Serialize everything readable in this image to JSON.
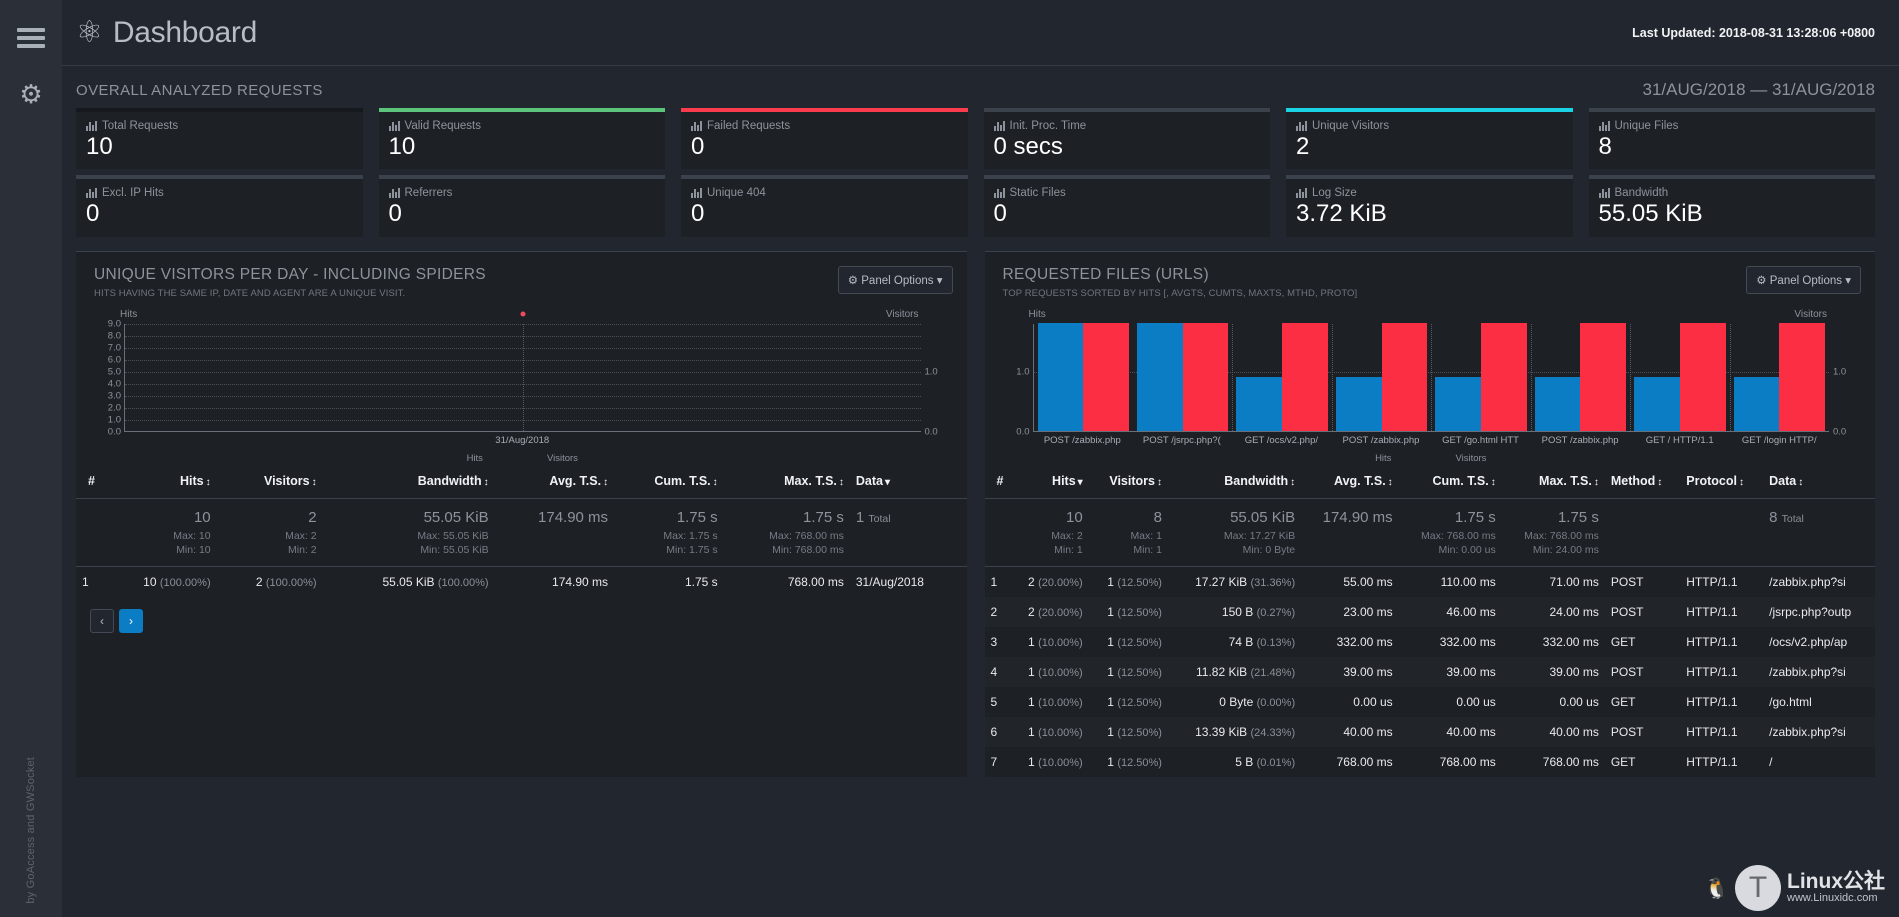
{
  "rail": {
    "menu_icon": "hamburger-icon",
    "settings_icon": "gear-icon",
    "credit": "by GoAccess and GWSocket"
  },
  "header": {
    "logo_icon": "goaccess-logo-icon",
    "title": "Dashboard",
    "last_updated": "Last Updated: 2018-08-31 13:28:06 +0800"
  },
  "overview": {
    "title": "OVERALL ANALYZED REQUESTS",
    "date_range": "31/AUG/2018 — 31/AUG/2018",
    "cards": [
      {
        "label": "Total Requests",
        "value": "10",
        "accent": "#15181d",
        "sub_label": "Excl. IP Hits",
        "sub_value": "0"
      },
      {
        "label": "Valid Requests",
        "value": "10",
        "accent": "#5cc47c",
        "sub_label": "Referrers",
        "sub_value": "0"
      },
      {
        "label": "Failed Requests",
        "value": "0",
        "accent": "#fb3b4e",
        "sub_label": "Unique 404",
        "sub_value": "0"
      },
      {
        "label": "Init. Proc. Time",
        "value": "0 secs",
        "accent": "#3c424c",
        "sub_label": "Static Files",
        "sub_value": "0"
      },
      {
        "label": "Unique Visitors",
        "value": "2",
        "accent": "#1ad4e6",
        "sub_label": "Log Size",
        "sub_value": "3.72 KiB"
      },
      {
        "label": "Unique Files",
        "value": "8",
        "accent": "#3c424c",
        "sub_label": "Bandwidth",
        "sub_value": "55.05 KiB"
      }
    ]
  },
  "panel_left": {
    "title": "UNIQUE VISITORS PER DAY - INCLUDING SPIDERS",
    "subtitle": "HITS HAVING THE SAME IP, DATE AND AGENT ARE A UNIQUE VISIT.",
    "options_label": "Panel Options",
    "options_icon": "gear-icon",
    "headers": [
      {
        "label": "#",
        "sort": ""
      },
      {
        "label": "Hits",
        "sort": "both"
      },
      {
        "label": "Visitors",
        "sort": "both"
      },
      {
        "label": "Bandwidth",
        "sort": "both"
      },
      {
        "label": "Avg. T.S.",
        "sort": "both"
      },
      {
        "label": "Cum. T.S.",
        "sort": "both"
      },
      {
        "label": "Max. T.S.",
        "sort": "both"
      },
      {
        "label": "Data",
        "sort": "desc"
      }
    ],
    "summary": {
      "hits": "10",
      "visitors": "2",
      "bandwidth": "55.05 KiB",
      "avg_ts": "174.90 ms",
      "cum_ts": "1.75 s",
      "max_ts": "1.75 s",
      "data": "1",
      "data_total_label": "Total",
      "max": {
        "hits": "Max: 10",
        "visitors": "Max: 2",
        "bandwidth": "Max: 55.05 KiB",
        "avg_ts": "",
        "cum_ts": "Max: 1.75 s",
        "max_ts": "Max: 768.00 ms"
      },
      "min": {
        "hits": "Min: 10",
        "visitors": "Min: 2",
        "bandwidth": "Min: 55.05 KiB",
        "avg_ts": "",
        "cum_ts": "Min: 1.75 s",
        "max_ts": "Min: 768.00 ms"
      }
    },
    "rows": [
      {
        "idx": "1",
        "hits": "10",
        "hits_pct": "(100.00%)",
        "visitors": "2",
        "visitors_pct": "(100.00%)",
        "bandwidth": "55.05 KiB",
        "bandwidth_pct": "(100.00%)",
        "avg_ts": "174.90 ms",
        "cum_ts": "1.75 s",
        "max_ts": "768.00 ms",
        "data": "31/Aug/2018"
      }
    ],
    "pager": {
      "prev": "‹",
      "next": "›"
    }
  },
  "panel_right": {
    "title": "REQUESTED FILES (URLS)",
    "subtitle": "TOP REQUESTS SORTED BY HITS [, AVGTS, CUMTS, MAXTS, MTHD, PROTO]",
    "options_label": "Panel Options",
    "options_icon": "gear-icon",
    "headers": [
      {
        "label": "#",
        "sort": ""
      },
      {
        "label": "Hits",
        "sort": "desc"
      },
      {
        "label": "Visitors",
        "sort": "both"
      },
      {
        "label": "Bandwidth",
        "sort": "both"
      },
      {
        "label": "Avg. T.S.",
        "sort": "both"
      },
      {
        "label": "Cum. T.S.",
        "sort": "both"
      },
      {
        "label": "Max. T.S.",
        "sort": "both"
      },
      {
        "label": "Method",
        "sort": "both"
      },
      {
        "label": "Protocol",
        "sort": "both"
      },
      {
        "label": "Data",
        "sort": "both"
      }
    ],
    "summary": {
      "hits": "10",
      "visitors": "8",
      "bandwidth": "55.05 KiB",
      "avg_ts": "174.90 ms",
      "cum_ts": "1.75 s",
      "max_ts": "1.75 s",
      "data": "8",
      "data_total_label": "Total",
      "max": {
        "hits": "Max: 2",
        "visitors": "Max: 1",
        "bandwidth": "Max: 17.27 KiB",
        "avg_ts": "",
        "cum_ts": "Max: 768.00 ms",
        "max_ts": "Max: 768.00 ms"
      },
      "min": {
        "hits": "Min: 1",
        "visitors": "Min: 1",
        "bandwidth": "Min: 0 Byte",
        "avg_ts": "",
        "cum_ts": "Min: 0.00 us",
        "max_ts": "Min: 24.00 ms"
      }
    },
    "rows": [
      {
        "idx": "1",
        "hits": "2",
        "hits_pct": "(20.00%)",
        "visitors": "1",
        "visitors_pct": "(12.50%)",
        "bandwidth": "17.27 KiB",
        "bandwidth_pct": "(31.36%)",
        "avg_ts": "55.00 ms",
        "cum_ts": "110.00 ms",
        "max_ts": "71.00 ms",
        "method": "POST",
        "protocol": "HTTP/1.1",
        "data": "/zabbix.php?si"
      },
      {
        "idx": "2",
        "hits": "2",
        "hits_pct": "(20.00%)",
        "visitors": "1",
        "visitors_pct": "(12.50%)",
        "bandwidth": "150 B",
        "bandwidth_pct": "(0.27%)",
        "avg_ts": "23.00 ms",
        "cum_ts": "46.00 ms",
        "max_ts": "24.00 ms",
        "method": "POST",
        "protocol": "HTTP/1.1",
        "data": "/jsrpc.php?outp"
      },
      {
        "idx": "3",
        "hits": "1",
        "hits_pct": "(10.00%)",
        "visitors": "1",
        "visitors_pct": "(12.50%)",
        "bandwidth": "74 B",
        "bandwidth_pct": "(0.13%)",
        "avg_ts": "332.00 ms",
        "cum_ts": "332.00 ms",
        "max_ts": "332.00 ms",
        "method": "GET",
        "protocol": "HTTP/1.1",
        "data": "/ocs/v2.php/ap"
      },
      {
        "idx": "4",
        "hits": "1",
        "hits_pct": "(10.00%)",
        "visitors": "1",
        "visitors_pct": "(12.50%)",
        "bandwidth": "11.82 KiB",
        "bandwidth_pct": "(21.48%)",
        "avg_ts": "39.00 ms",
        "cum_ts": "39.00 ms",
        "max_ts": "39.00 ms",
        "method": "POST",
        "protocol": "HTTP/1.1",
        "data": "/zabbix.php?si"
      },
      {
        "idx": "5",
        "hits": "1",
        "hits_pct": "(10.00%)",
        "visitors": "1",
        "visitors_pct": "(12.50%)",
        "bandwidth": "0 Byte",
        "bandwidth_pct": "(0.00%)",
        "avg_ts": "0.00 us",
        "cum_ts": "0.00 us",
        "max_ts": "0.00 us",
        "method": "GET",
        "protocol": "HTTP/1.1",
        "data": "/go.html"
      },
      {
        "idx": "6",
        "hits": "1",
        "hits_pct": "(10.00%)",
        "visitors": "1",
        "visitors_pct": "(12.50%)",
        "bandwidth": "13.39 KiB",
        "bandwidth_pct": "(24.33%)",
        "avg_ts": "40.00 ms",
        "cum_ts": "40.00 ms",
        "max_ts": "40.00 ms",
        "method": "POST",
        "protocol": "HTTP/1.1",
        "data": "/zabbix.php?si"
      },
      {
        "idx": "7",
        "hits": "1",
        "hits_pct": "(10.00%)",
        "visitors": "1",
        "visitors_pct": "(12.50%)",
        "bandwidth": "5 B",
        "bandwidth_pct": "(0.01%)",
        "avg_ts": "768.00 ms",
        "cum_ts": "768.00 ms",
        "max_ts": "768.00 ms",
        "method": "GET",
        "protocol": "HTTP/1.1",
        "data": "/"
      }
    ]
  },
  "chart_data": [
    {
      "type": "line",
      "title": "UNIQUE VISITORS PER DAY - INCLUDING SPIDERS",
      "xlabel": "",
      "ylabel": "Hits",
      "y2label": "Visitors",
      "categories": [
        "31/Aug/2018"
      ],
      "series": [
        {
          "name": "Hits",
          "values": [
            10
          ]
        },
        {
          "name": "Visitors",
          "values": [
            2
          ]
        }
      ],
      "yticks": [
        "9.0",
        "8.0",
        "7.0",
        "6.0",
        "5.0",
        "4.0",
        "3.0",
        "2.0",
        "1.0",
        "0.0"
      ],
      "ylim": [
        0,
        10
      ],
      "y2ticks": [
        "1.0",
        "0.0"
      ],
      "y2lim": [
        0,
        2
      ],
      "grid": true,
      "legend": [
        "Hits",
        "Visitors"
      ],
      "legend_position": "bottom"
    },
    {
      "type": "bar",
      "title": "REQUESTED FILES (URLS)",
      "xlabel": "",
      "ylabel": "Hits",
      "y2label": "Visitors",
      "categories": [
        "POST /zabbix.php",
        "POST /jsrpc.php?(",
        "GET /ocs/v2.php/",
        "POST /zabbix.php",
        "GET /go.html HTT",
        "POST /zabbix.php",
        "GET / HTTP/1.1",
        "GET /login HTTP/"
      ],
      "series": [
        {
          "name": "Hits",
          "values": [
            2,
            2,
            1,
            1,
            1,
            1,
            1,
            1
          ]
        },
        {
          "name": "Visitors",
          "values": [
            1,
            1,
            1,
            1,
            1,
            1,
            1,
            1
          ]
        }
      ],
      "yticks": [
        "1.0",
        "0.0"
      ],
      "ylim": [
        0,
        2
      ],
      "y2ticks": [
        "1.0",
        "0.0"
      ],
      "y2lim": [
        0,
        1
      ],
      "grid": true,
      "legend": [
        "Hits",
        "Visitors"
      ],
      "legend_position": "bottom",
      "colors": {
        "hits": "#0b7dc4",
        "visitors": "#fb2e44"
      }
    }
  ],
  "watermark": {
    "brand": "Linux公社",
    "url": "www.Linuxidc.com",
    "icon": "penguin-icon"
  }
}
